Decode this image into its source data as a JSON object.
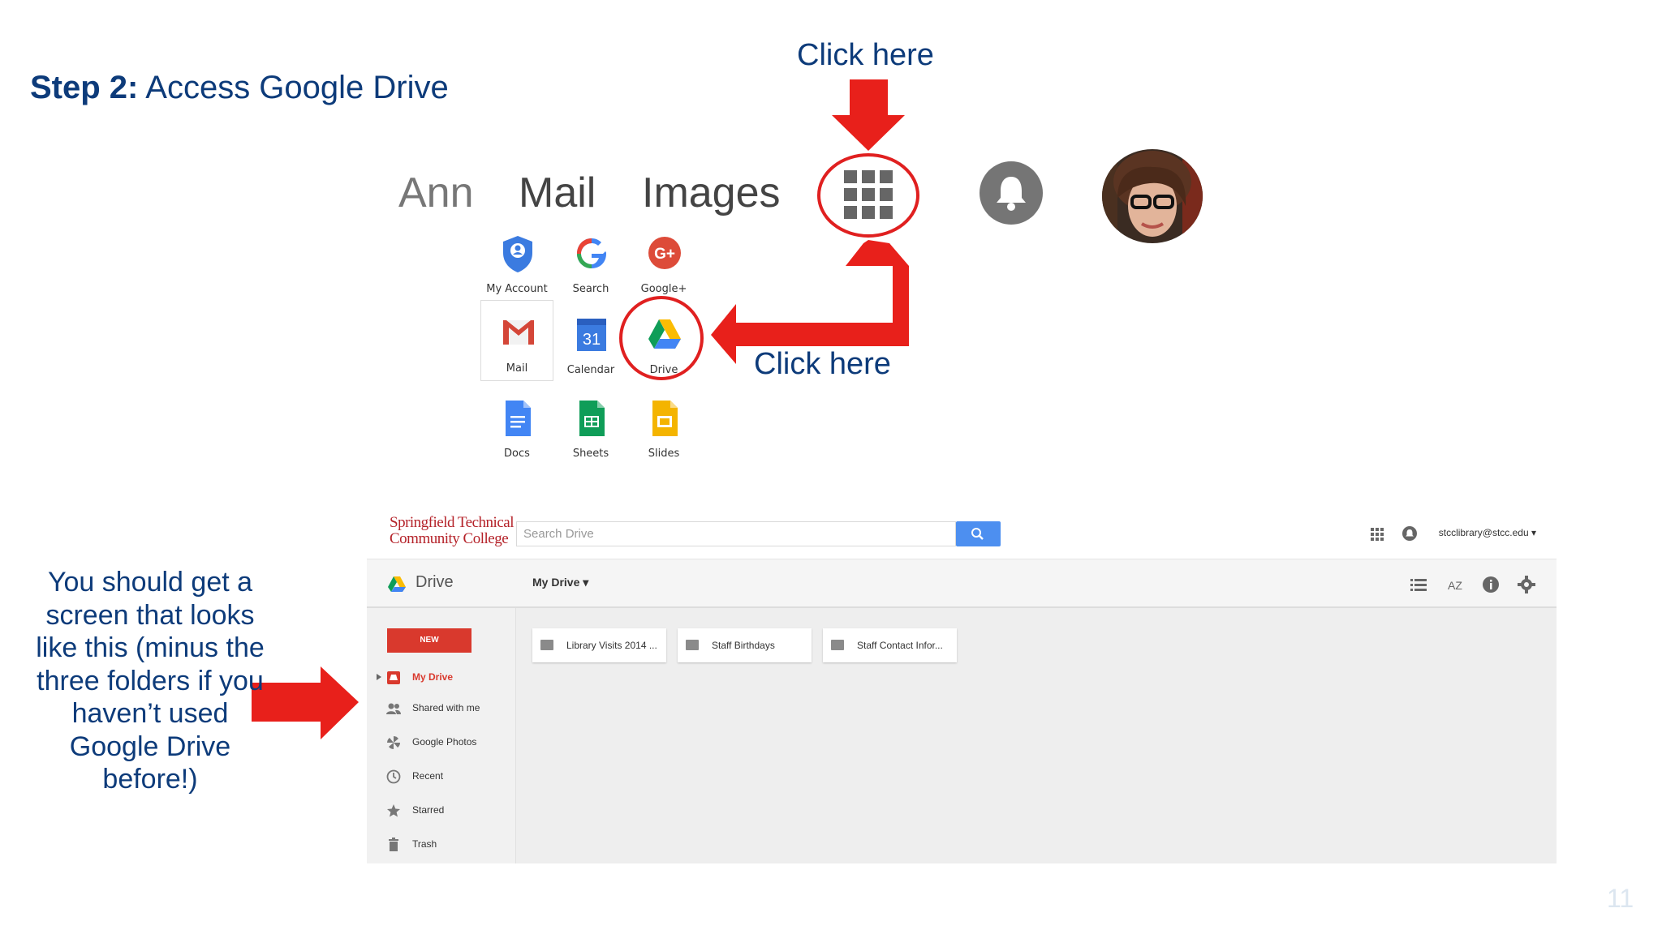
{
  "slide": {
    "title_bold": "Step 2:",
    "title_rest": " Access Google Drive",
    "callout_top": "Click here",
    "callout_right": "Click here",
    "side_note": "You should get a screen that looks like this (minus the three folders if you haven’t used Google Drive before!)",
    "page_number": "11"
  },
  "google_bar": {
    "links": [
      "Ann",
      "Mail",
      "Images"
    ]
  },
  "apps": [
    {
      "label": "My Account",
      "icon": "my-account-icon"
    },
    {
      "label": "Search",
      "icon": "google-g-icon"
    },
    {
      "label": "Google+",
      "icon": "google-plus-icon"
    },
    {
      "label": "Mail",
      "icon": "gmail-icon"
    },
    {
      "label": "Calendar",
      "icon": "calendar-icon",
      "day": "31"
    },
    {
      "label": "Drive",
      "icon": "drive-icon"
    },
    {
      "label": "Docs",
      "icon": "docs-icon"
    },
    {
      "label": "Sheets",
      "icon": "sheets-icon"
    },
    {
      "label": "Slides",
      "icon": "slides-icon"
    }
  ],
  "drive": {
    "logo_line1": "Springfield Technical",
    "logo_line2": "Community College",
    "search_placeholder": "Search Drive",
    "account": "stcclibrary@stcc.edu ▾",
    "toolbar_title": "Drive",
    "toolbar_location": "My Drive ▾",
    "new_label": "NEW",
    "sidebar": [
      "My Drive",
      "Shared with me",
      "Google Photos",
      "Recent",
      "Starred",
      "Trash"
    ],
    "folders": [
      "Library Visits 2014 ...",
      "Staff Birthdays",
      "Staff Contact Infor..."
    ]
  },
  "colors": {
    "accent_red": "#e8201b",
    "title_blue": "#0d3b7a",
    "drive_new": "#d9392d",
    "search_button": "#4d8ff0"
  }
}
